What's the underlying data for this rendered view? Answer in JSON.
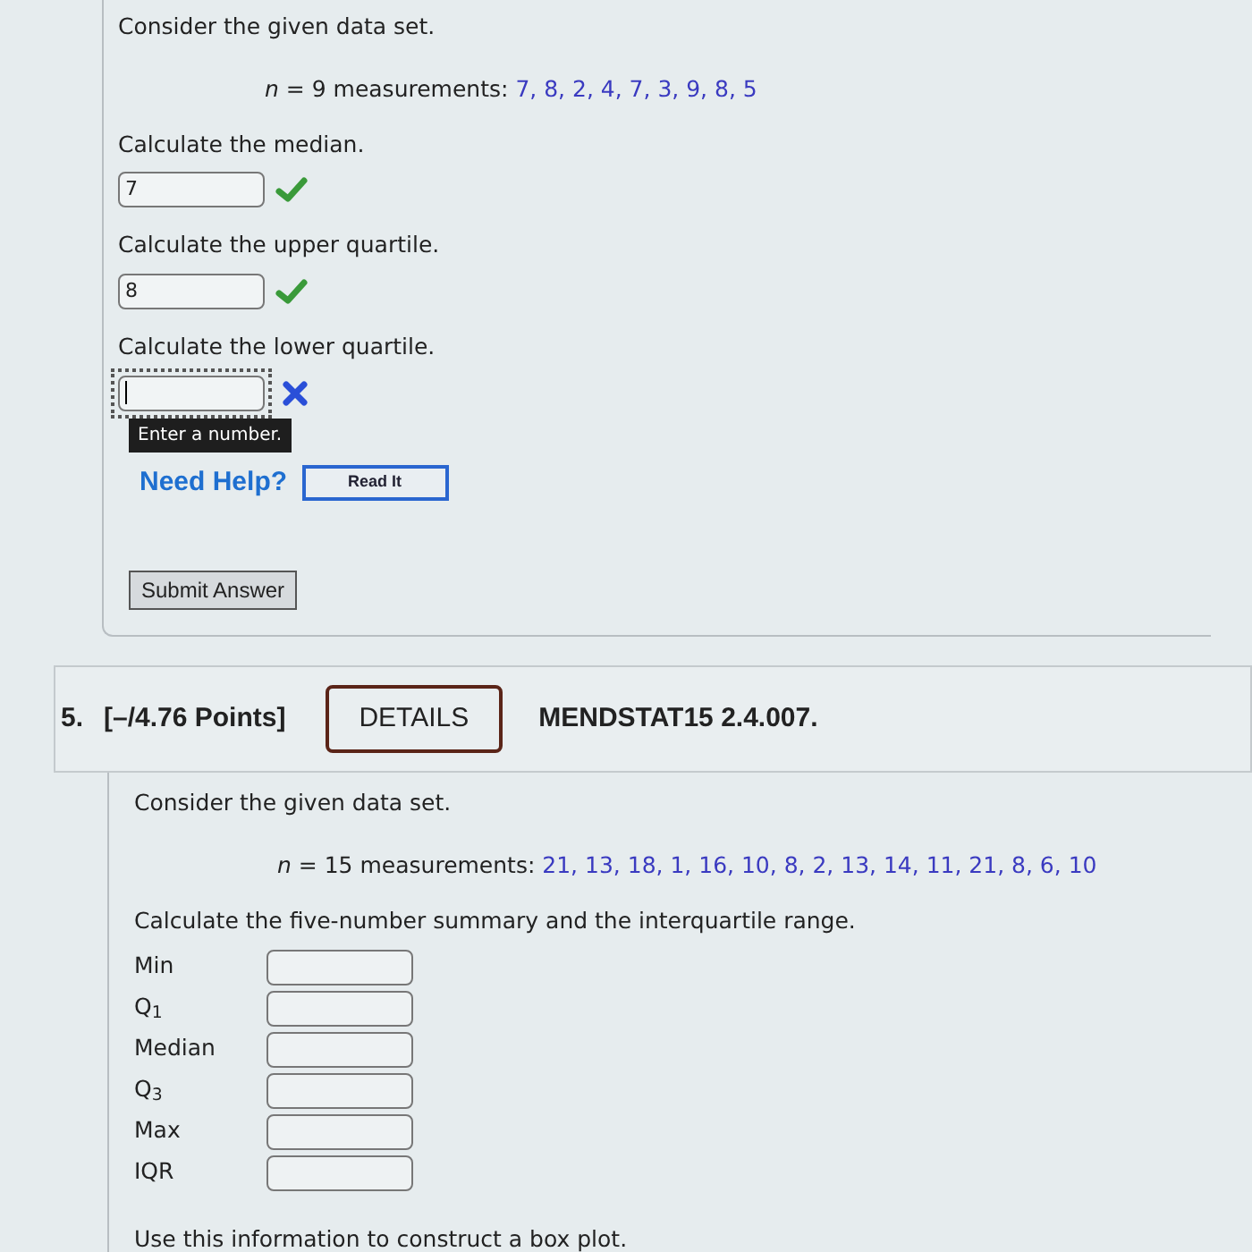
{
  "question_4": {
    "intro": "Consider the given data set.",
    "dataset": "*n* = 9 measurements: ",
    "values": "7, 8, 2, 4, 7, 3, 9, 8, 5",
    "parts": [
      {
        "prompt": "Calculate the median.",
        "value": "7",
        "correct": true,
        "focused": false
      },
      {
        "prompt": "Calculate the upper quartile.",
        "value": "8",
        "correct": true,
        "focused": false
      },
      {
        "prompt": "Calculate the lower quartile.",
        "correct": false,
        "focused": true,
        "tooltip": "Enter a number."
      }
    ],
    "help": {
      "label": "Need Help?",
      "button": "Read It"
    },
    "submit": "Submit Answer"
  },
  "question_5": {
    "number": "5.",
    "points": "[–/4.76 Points]",
    "details": "DETAILS",
    "code": "MENDSTAT15 2.4.007.",
    "intro": "Consider the given data set.",
    "dataset": "*n* = 15 measurements: ",
    "values": "21, 13, 18, 1, 16, 10, 8, 2, 13, 14, 11, 21, 8, 6, 10",
    "prompt": "Calculate the five-number summary and the interquartile range.",
    "fields": [
      {
        "label": "Min"
      },
      {
        "label": "Q$_{1}$"
      },
      {
        "label": "Median"
      },
      {
        "label": "Q$_{3}$"
      },
      {
        "label": "Max"
      },
      {
        "label": "IQR"
      }
    ],
    "footer": "Use this information to construct a box plot."
  }
}
